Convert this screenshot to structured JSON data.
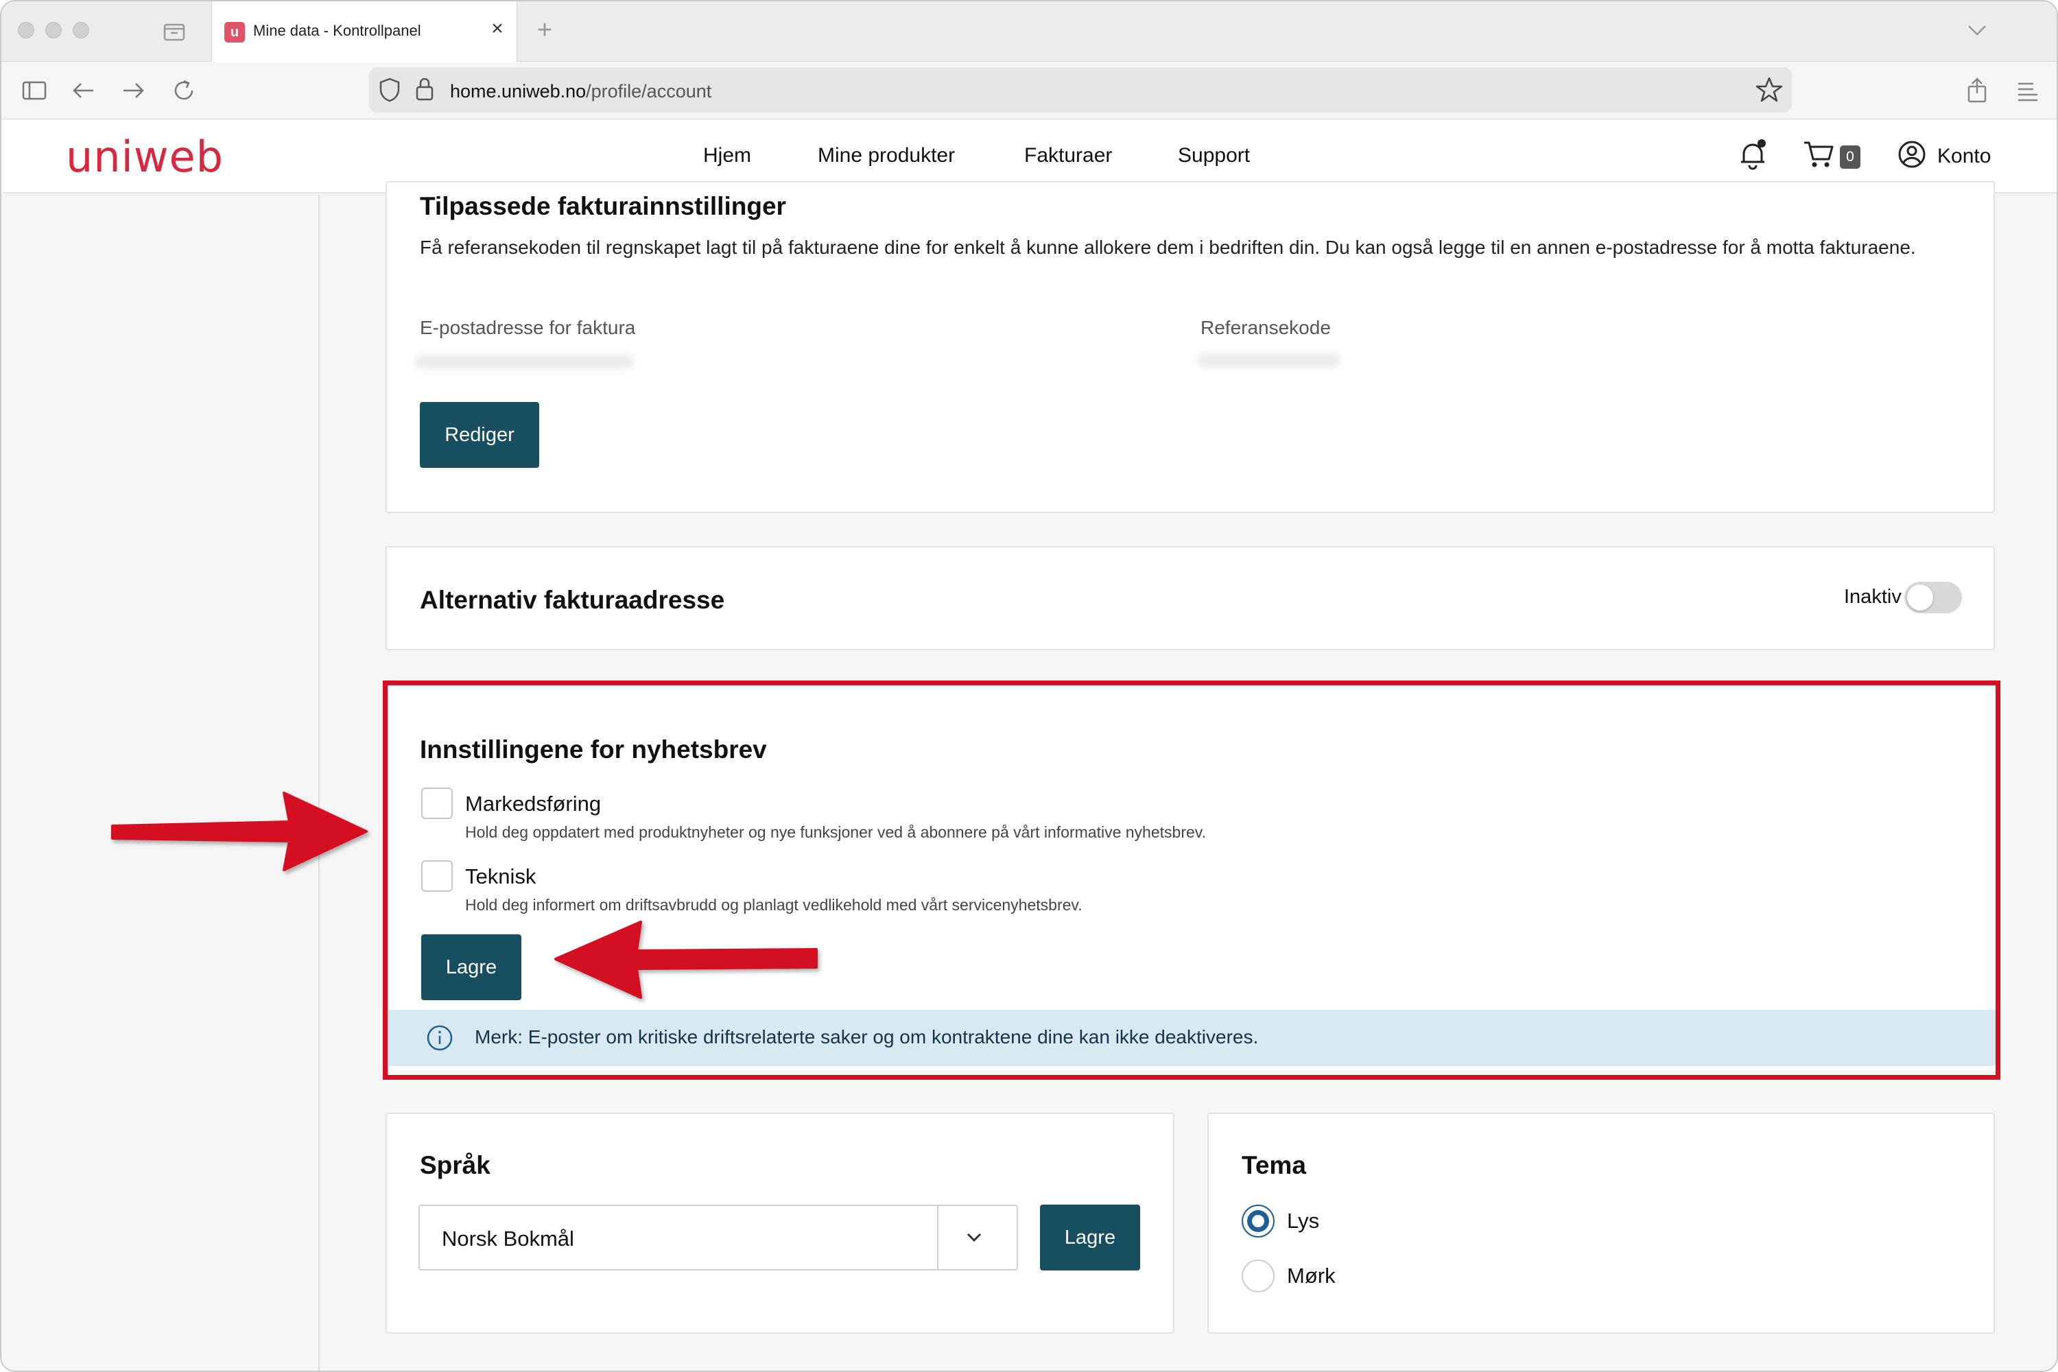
{
  "browser": {
    "tab_title": "Mine data - Kontrollpanel",
    "favicon_letter": "u",
    "tab_close": "×",
    "new_tab": "+",
    "url_host": "home.uniweb.no",
    "url_path": "/profile/account"
  },
  "header": {
    "logo": "uniweb",
    "menu": [
      "Hjem",
      "Mine produkter",
      "Fakturaer",
      "Support"
    ],
    "cart_count": "0",
    "account_label": "Konto"
  },
  "invoice_settings": {
    "title": "Tilpassede fakturainnstillinger",
    "description": "Få referansekoden til regnskapet lagt til på fakturaene dine for enkelt å kunne allokere dem i bedriften din. Du kan også legge til en annen e-postadresse for å motta fakturaene.",
    "email_label": "E-postadresse for faktura",
    "reference_label": "Referansekode",
    "edit_button": "Rediger"
  },
  "alt_address": {
    "title": "Alternativ fakturaadresse",
    "status_label": "Inaktiv",
    "enabled": false
  },
  "newsletter": {
    "title": "Innstillingene for nyhetsbrev",
    "options": [
      {
        "label": "Markedsføring",
        "help": "Hold deg oppdatert med produktnyheter og nye funksjoner ved å abonnere på vårt informative nyhetsbrev.",
        "checked": false
      },
      {
        "label": "Teknisk",
        "help": "Hold deg informert om driftsavbrudd og planlagt vedlikehold med vårt servicenyhetsbrev.",
        "checked": false
      }
    ],
    "save_button": "Lagre",
    "notice": "Merk: E-poster om kritiske driftsrelaterte saker og om kontraktene dine kan ikke deaktiveres."
  },
  "language": {
    "title": "Språk",
    "selected": "Norsk Bokmål",
    "save_button": "Lagre"
  },
  "theme": {
    "title": "Tema",
    "options": [
      {
        "label": "Lys",
        "selected": true
      },
      {
        "label": "Mørk",
        "selected": false
      }
    ]
  },
  "colors": {
    "brand": "#d8283f",
    "primary_button": "#174e60",
    "annotation": "#d50f22",
    "notice_bg": "#d8e9f4",
    "radio_selected": "#1d5e98"
  },
  "icons": [
    "shield-icon",
    "lock-icon",
    "star-icon",
    "bell-icon",
    "cart-icon",
    "account-icon",
    "info-icon",
    "chevron-down-icon"
  ]
}
